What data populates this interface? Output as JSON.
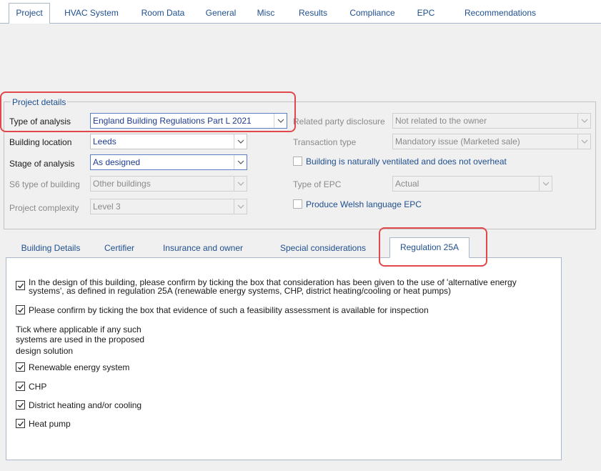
{
  "top_tabs": [
    "Project",
    "HVAC System",
    "Room Data",
    "General",
    "Misc",
    "Results",
    "Compliance",
    "EPC",
    "Recommendations"
  ],
  "active_top_tab": "Project",
  "project_details": {
    "title": "Project details",
    "type_of_analysis": {
      "label": "Type of analysis",
      "value": "England Building Regulations Part L 2021"
    },
    "building_location": {
      "label": "Building location",
      "value": "Leeds"
    },
    "stage_of_analysis": {
      "label": "Stage of analysis",
      "value": "As designed"
    },
    "s6_type": {
      "label": "S6 type of building",
      "value": "Other buildings"
    },
    "project_complexity": {
      "label": "Project complexity",
      "value": "Level 3"
    },
    "related_party": {
      "label": "Related party disclosure",
      "value": "Not related to the owner"
    },
    "transaction_type": {
      "label": "Transaction type",
      "value": "Mandatory issue (Marketed sale)"
    },
    "naturally_ventilated": {
      "label": "Building is naturally ventilated and does not overheat",
      "checked": false
    },
    "type_of_epc": {
      "label": "Type of EPC",
      "value": "Actual"
    },
    "welsh_epc": {
      "label": "Produce Welsh language EPC",
      "checked": false
    }
  },
  "inner_tabs": [
    "Building Details",
    "Certifier",
    "Insurance and owner",
    "Special considerations",
    "Regulation 25A"
  ],
  "active_inner_tab": "Regulation 25A",
  "regulation_25a": {
    "confirm_alt_energy": {
      "line1": "In the design of this building, please confirm by ticking the box that consideration has been given to the use of 'alternative energy",
      "line2": "systems', as defined in regulation 25A (renewable energy systems, CHP, district heating/cooling or heat pumps)",
      "checked": true
    },
    "confirm_feasibility": {
      "label": "Please confirm by ticking the box that evidence of such a feasibility assessment is available for inspection",
      "checked": true
    },
    "tick_note": {
      "line1": "Tick where applicable if any such",
      "line2": "systems are used in the proposed",
      "line3": "design solution"
    },
    "renewable": {
      "label": "Renewable energy system",
      "checked": true
    },
    "chp": {
      "label": "CHP",
      "checked": true
    },
    "district": {
      "label": "District heating and/or cooling",
      "checked": true
    },
    "heat_pump": {
      "label": "Heat pump",
      "checked": true
    }
  },
  "colors": {
    "highlight": "#e0484b",
    "link_blue": "#1f4f8f",
    "value_blue": "#1f3c8f",
    "panel_bg": "#f0f0f0"
  }
}
